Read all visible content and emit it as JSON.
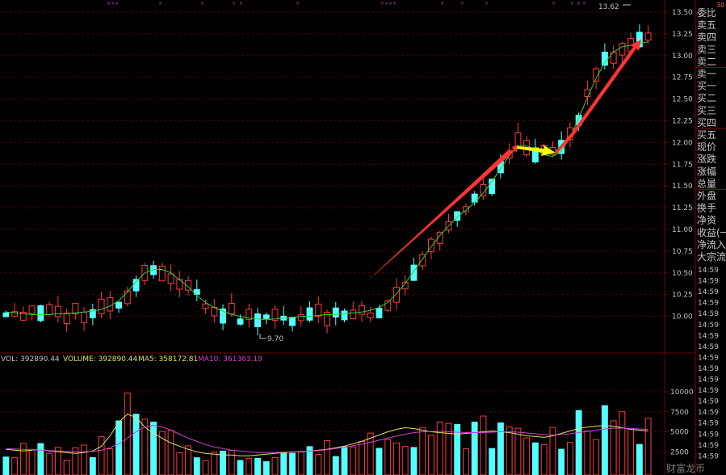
{
  "chart_data": [
    {
      "type": "candlestick",
      "title": "",
      "ylim": [
        9.6,
        13.6
      ],
      "y_ticks": [
        "13.50",
        "13.25",
        "13.00",
        "12.75",
        "12.50",
        "12.25",
        "12.00",
        "11.75",
        "11.50",
        "11.25",
        "11.00",
        "10.75",
        "10.50",
        "10.25",
        "10.00"
      ],
      "annotations": {
        "high": "13.62",
        "low": "9.70"
      },
      "ma_series": [
        {
          "name": "MA (green)",
          "color": "#2fd22f",
          "values": [
            10.05,
            10.04,
            10.03,
            10.02,
            10.02,
            10.02,
            10.03,
            10.03,
            10.04,
            10.05,
            10.06,
            10.08,
            10.12,
            10.18,
            10.28,
            10.4,
            10.5,
            10.54,
            10.54,
            10.5,
            10.42,
            10.34,
            10.24,
            10.16,
            10.1,
            10.06,
            10.02,
            10.0,
            9.98,
            9.97,
            9.96,
            9.97,
            9.98,
            9.99,
            10.0,
            10.0,
            10.01,
            10.02,
            10.02,
            10.03,
            10.04,
            10.05,
            10.07,
            10.1,
            10.16,
            10.26,
            10.38,
            10.52,
            10.66,
            10.8,
            10.93,
            11.04,
            11.14,
            11.22,
            11.31,
            11.42,
            11.55,
            11.7,
            11.85,
            11.96,
            11.96,
            11.92,
            11.86,
            11.84,
            11.9,
            12.06,
            12.28,
            12.52,
            12.74,
            12.92,
            13.04,
            13.1,
            13.12,
            13.14,
            13.16
          ]
        }
      ]
    },
    {
      "type": "bar",
      "title": "",
      "ylim": [
        0,
        12000
      ],
      "y_ticks": [
        "10000",
        "7500",
        "5000",
        "2500"
      ],
      "ma_series": [
        {
          "name": "MA5",
          "color": "#e0e060",
          "values": [
            2800,
            2700,
            2600,
            2700,
            2800,
            2600,
            2500,
            2400,
            2300,
            2400,
            2600,
            3200,
            4500,
            6200,
            7200,
            6800,
            5600,
            4800,
            4200,
            3600,
            3200,
            2800,
            2500,
            2300,
            2200,
            2100,
            2100,
            2000,
            2000,
            2100,
            2200,
            2300,
            2400,
            2500,
            2500,
            2600,
            2700,
            2800,
            3000,
            3200,
            3500,
            3800,
            4200,
            4600,
            5000,
            5300,
            5500,
            5400,
            5200,
            5000,
            4900,
            4800,
            4700,
            4800,
            4900,
            5000,
            5100,
            5000,
            4900,
            4700,
            4500,
            4400,
            4300,
            4500,
            4800,
            5100,
            5400,
            5600,
            5700,
            5800,
            5700,
            5500,
            5300,
            5200,
            5100
          ]
        },
        {
          "name": "MA10",
          "color": "#d040d0",
          "values": [
            2900,
            2850,
            2800,
            2750,
            2700,
            2650,
            2600,
            2550,
            2500,
            2500,
            2550,
            2700,
            3000,
            3500,
            4200,
            5000,
            5600,
            5800,
            5600,
            5200,
            4700,
            4200,
            3800,
            3400,
            3100,
            2900,
            2700,
            2600,
            2500,
            2400,
            2400,
            2400,
            2450,
            2500,
            2550,
            2600,
            2650,
            2750,
            2900,
            3050,
            3250,
            3450,
            3700,
            3950,
            4200,
            4450,
            4700,
            4900,
            5000,
            5050,
            5050,
            5000,
            4950,
            4900,
            4900,
            4900,
            4950,
            5000,
            5000,
            4950,
            4850,
            4750,
            4650,
            4600,
            4650,
            4750,
            4900,
            5050,
            5200,
            5350,
            5450,
            5450,
            5400,
            5350,
            5300
          ]
        }
      ]
    }
  ],
  "chart_overlay": {
    "colors": {
      "up": "#ff3c3c",
      "down": "#54ffff",
      "arrow_red": "#ff3333",
      "arrow_yellow": "#ffff00",
      "grid_red": "#6a0000",
      "ma_green": "#2fd22f"
    }
  },
  "volume_legend": {
    "vol": "VOL: 392890.44",
    "volume": "VOLUME: 392890.44",
    "ma5": "MA5: 358172.81",
    "ma10": "MA10: 361363.19",
    "colors": {
      "vol": "#c0c0c0",
      "volume": "#e0e060",
      "ma5": "#e0e060",
      "ma10": "#d040d0"
    }
  },
  "quote_panel": {
    "header_value": "30",
    "labels": [
      "委比",
      "卖五",
      "卖四",
      "卖三",
      "卖二",
      "卖一",
      "买一",
      "买二",
      "买三",
      "买四",
      "买五",
      "现价",
      "涨跌",
      "涨幅",
      "总量",
      "外盘",
      "换手",
      "净资",
      "收益(一",
      "净流入",
      "大宗流"
    ],
    "times": [
      "14:59",
      "14:59",
      "14:59",
      "14:59",
      "14:59",
      "14:59",
      "14:59",
      "14:59",
      "14:59",
      "14:59",
      "14:59",
      "14:59",
      "14:59",
      "14:59",
      "14:59",
      "14:59",
      "14:59",
      "14:59"
    ]
  },
  "watermark": "财富龙币"
}
